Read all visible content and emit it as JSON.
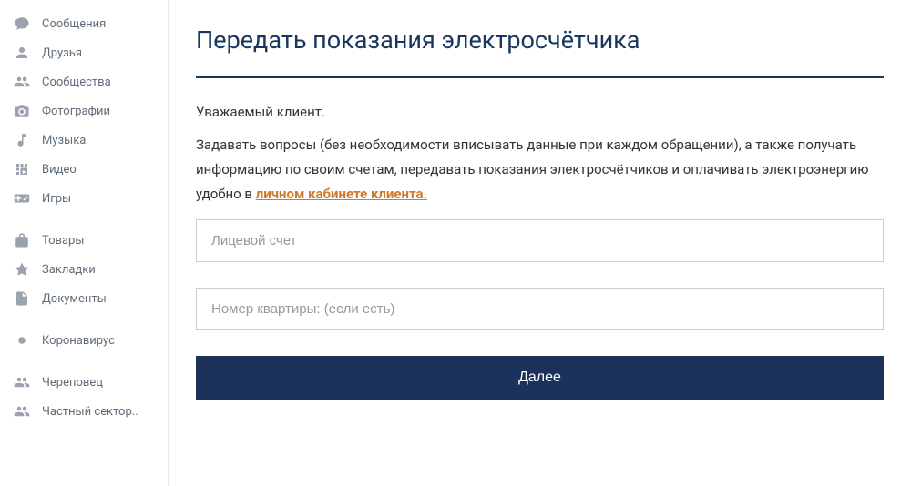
{
  "sidebar": {
    "group1": [
      {
        "icon": "chat",
        "label": "Сообщения"
      },
      {
        "icon": "user",
        "label": "Друзья"
      },
      {
        "icon": "users",
        "label": "Сообщества"
      },
      {
        "icon": "camera",
        "label": "Фотографии"
      },
      {
        "icon": "music",
        "label": "Музыка"
      },
      {
        "icon": "video",
        "label": "Видео"
      },
      {
        "icon": "game",
        "label": "Игры"
      }
    ],
    "group2": [
      {
        "icon": "bag",
        "label": "Товары"
      },
      {
        "icon": "star",
        "label": "Закладки"
      },
      {
        "icon": "doc",
        "label": "Документы"
      }
    ],
    "group3": [
      {
        "icon": "virus",
        "label": "Коронавирус"
      }
    ],
    "group4": [
      {
        "icon": "group",
        "label": "Череповец"
      },
      {
        "icon": "group",
        "label": "Частный сектор.."
      }
    ]
  },
  "main": {
    "title": "Передать показания электросчётчика",
    "greeting": "Уважаемый клиент.",
    "para_before_link": "Задавать вопросы (без необходимости вписывать данные при каждом обращении), а также получать информацию по своим счетам, передавать показания электросчётчиков и оплачивать электроэнергию удобно в ",
    "link_text": "личном кабинете клиента.",
    "account_placeholder": "Лицевой счет",
    "apt_placeholder": "Номер квартиры: (если есть)",
    "next_label": "Далее"
  }
}
